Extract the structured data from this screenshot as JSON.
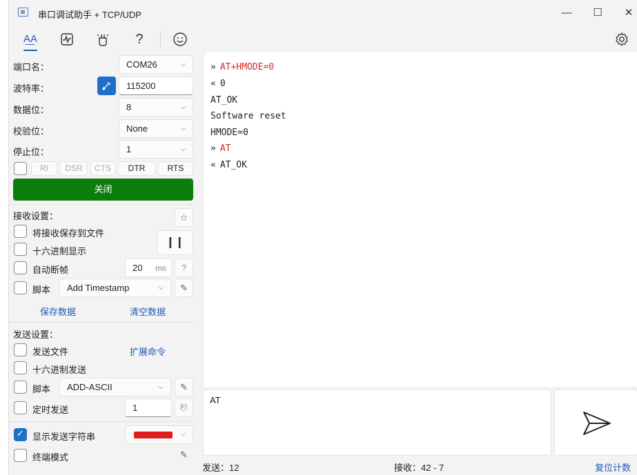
{
  "window": {
    "title": "串口调试助手 + TCP/UDP"
  },
  "toolbar": {
    "items": [
      "font-icon",
      "waveform-icon",
      "plugin-icon",
      "help-icon",
      "smile-icon",
      "settings-icon"
    ]
  },
  "serial": {
    "port_label": "端口名：",
    "port_value": "COM26",
    "baud_label": "波特率：",
    "baud_value": "115200",
    "databits_label": "数据位：",
    "databits_value": "8",
    "parity_label": "校验位：",
    "parity_value": "None",
    "stopbits_label": "停止位：",
    "stopbits_value": "1",
    "pins": [
      "RI",
      "DSR",
      "CTS",
      "DTR",
      "RTS"
    ],
    "close_button": "关闭"
  },
  "receive_settings": {
    "title": "接收设置：",
    "save_to_file": "将接收保存到文件",
    "hex_display": "十六进制显示",
    "auto_frame": "自动断帧",
    "frame_value": "20",
    "frame_unit": "ms",
    "help": "?",
    "script_label": "脚本",
    "script_value": "Add Timestamp",
    "save_data": "保存数据",
    "clear_data": "清空数据"
  },
  "send_settings": {
    "title": "发送设置：",
    "send_file": "发送文件",
    "extend_cmd": "扩展命令",
    "hex_send": "十六进制发送",
    "script_label": "脚本",
    "script_value": "ADD-ASCII",
    "timed_send": "定时发送",
    "timed_value": "1",
    "timed_unit": "秒",
    "show_send_string": "显示发送字符串",
    "send_color": "#e01b1b",
    "terminal_mode": "终端模式"
  },
  "receive_log": [
    {
      "dir": "»",
      "text": "AT+HMODE=0",
      "sent": true
    },
    {
      "dir": "«",
      "text": "0",
      "sent": false
    },
    {
      "dir": "",
      "text": "AT_OK",
      "sent": false
    },
    {
      "dir": "",
      "text": "Software reset",
      "sent": false
    },
    {
      "dir": "",
      "text": "HMODE=0",
      "sent": false
    },
    {
      "dir": "»",
      "text": "AT",
      "sent": true
    },
    {
      "dir": "«",
      "text": "AT_OK",
      "sent": false
    }
  ],
  "send_input": {
    "value": "AT"
  },
  "status": {
    "sent": "发送：12",
    "received": "接收：42 - 7",
    "reset_count": "复位计数"
  }
}
